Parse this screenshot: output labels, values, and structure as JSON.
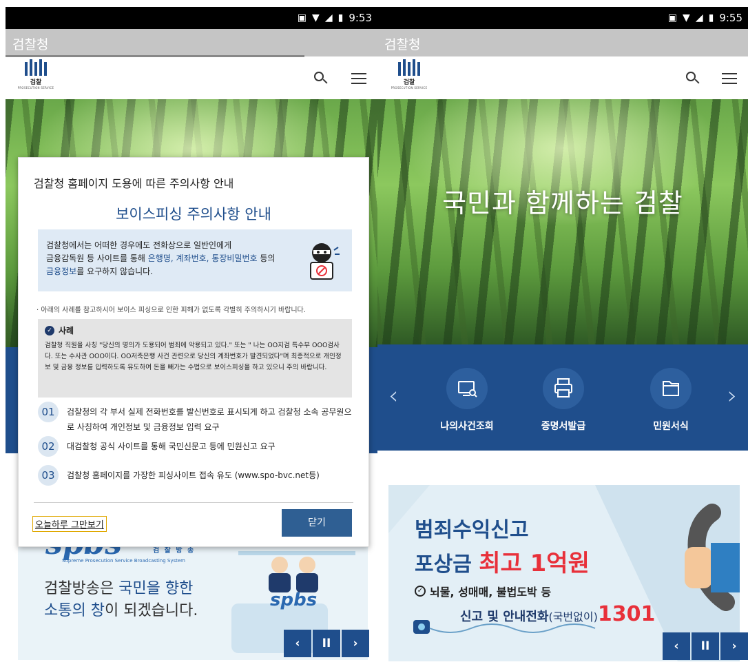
{
  "left": {
    "status_time": "9:53",
    "page_title": "검찰청",
    "logo_text": "검찰",
    "logo_subtext": "PROSECUTION SERVICE",
    "modal": {
      "title": "검찰청 홈페이지 도용에 따른 주의사항 안내",
      "subtitle": "보이스피싱 주의사항 안내",
      "warning_line1": "검찰청에서는 어떠한 경우에도 전화상으로 일반인에게",
      "warning_line2_a": "금융감독원 등 사이트를 통해 ",
      "warning_line2_b": "은행명, 계좌번호, 통장비밀번호",
      "warning_line2_c": " 등의",
      "warning_line3_a": "금융정보",
      "warning_line3_b": "를 요구하지 않습니다.",
      "note": "· 아래의 사례를 참고하시어 보이스 피싱으로 인한 피해가 없도록 각별히 주의하시기 바랍니다.",
      "case_title": "사례",
      "case_body": "검찰청 직원을 사칭 \"당신의 명의가 도용되어 범죄에 악용되고 있다.\" 또는 \" 나는 OO지검 특수부 OOO검사다. 또는 수사관 OOO이다. OO저축은행 사건 관련으로 당신의 계좌번호가 발견되었다\"며 최종적으로 개인정보 및 금융 정보를 입력하도록 유도하여 돈을 빼가는 수법으로 보이스피싱을 하고 있으니 주의 바랍니다.",
      "items": [
        {
          "num": "01",
          "text": "검찰청의 각 부서 실제 전화번호를 발신번호로 표시되게 하고 검찰청 소속 공무원으로 사칭하여 개인정보 및 금융정보 입력 요구"
        },
        {
          "num": "02",
          "text": "대검찰청 공식 사이트를 통해 국민신문고 등에 민원신고 요구"
        },
        {
          "num": "03",
          "text": "검찰청 홈페이지를 가장한 피싱사이트 접속 유도 (www.spo-bvc.net등)"
        }
      ],
      "dismiss_today": "오늘하루 그만보기",
      "close_button": "닫기"
    },
    "banner": {
      "logo_text": "spbs",
      "logo_suffix": "검 찰 방 송",
      "logo_caption": "Supreme Prosecution Service Broadcasting System",
      "line1_a": "검찰방송은 ",
      "line1_b": "국민을 향한",
      "line2_a": "소통의 창",
      "line2_b": "이 되겠습니다.",
      "desk_logo": "spbs"
    },
    "controls": {
      "prev": "‹",
      "pause": "II",
      "next": "›"
    }
  },
  "right": {
    "status_time": "9:55",
    "page_title": "검찰청",
    "logo_text": "검찰",
    "logo_subtext": "PROSECUTION SERVICE",
    "hero_title": "국민과 함께하는 검찰",
    "quick_menu": [
      {
        "label": "나의사건조회",
        "icon": "monitor-search-icon"
      },
      {
        "label": "증명서발급",
        "icon": "printer-icon"
      },
      {
        "label": "민원서식",
        "icon": "folder-icon"
      }
    ],
    "banner": {
      "line1": "범죄수익신고",
      "line2_a": "포상금 ",
      "line2_b": "최고 1억원",
      "line3": "뇌물, 성매매, 불법도박 등",
      "line4_a": "신고 및 안내전화",
      "line4_b": "(국번없이)",
      "line4_c": "1301"
    },
    "controls": {
      "prev": "‹",
      "pause": "II",
      "next": "›"
    }
  },
  "colors": {
    "brand_blue": "#1f4e8c",
    "red_accent": "#e8303a",
    "status_bar": "#000000",
    "title_bar": "#c5c5c5"
  }
}
